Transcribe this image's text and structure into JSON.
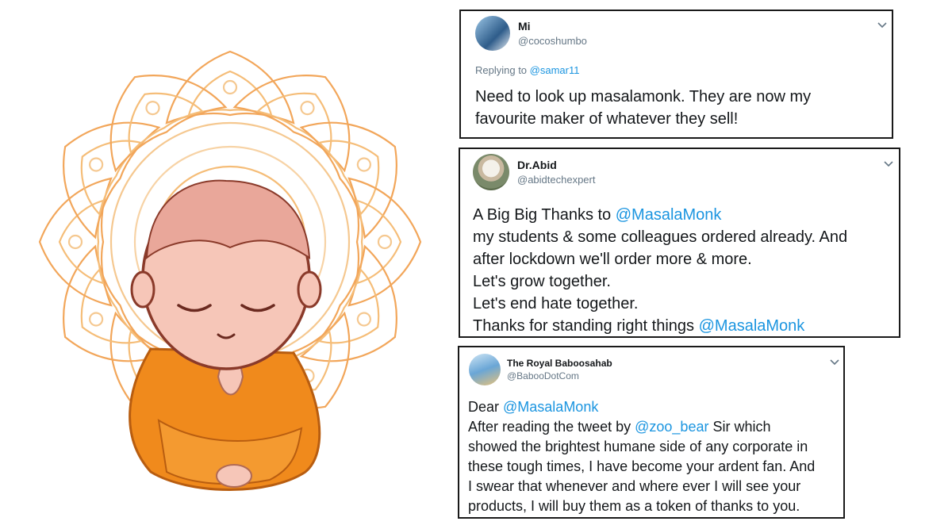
{
  "tweets": [
    {
      "name": "Mi",
      "handle": "@cocoshumbo",
      "reply_prefix": "Replying to",
      "reply_to": "@samar11",
      "lines": [
        "Need to look up masalamonk. They are now my",
        "favourite maker of whatever they sell!"
      ]
    },
    {
      "name": "Dr.Abid",
      "handle": "@abidtechexpert",
      "line1_text": "A Big Big Thanks to ",
      "line1_mention": "@MasalaMonk",
      "lines": [
        "my students & some colleagues ordered already. And",
        "after lockdown we'll order more & more.",
        "Let's grow together.",
        "Let's end hate together."
      ],
      "last_text": "Thanks for standing right things ",
      "last_mention": "@MasalaMonk"
    },
    {
      "name": "The Royal Baboosahab",
      "handle": "@BabooDotCom",
      "greeting": "Dear ",
      "greeting_mention": "@MasalaMonk",
      "line2_text": "After reading the tweet by ",
      "line2_mention": "@zoo_bear",
      "line2_rest": " Sir which",
      "lines": [
        "showed the brightest humane side of any corporate in",
        "these tough times, I have become your ardent fan. And",
        "I swear that whenever and where ever I will see your",
        "products, I will buy them as a token of thanks to you."
      ]
    }
  ],
  "colors": {
    "mention": "#1b95e0",
    "handle": "#657786",
    "mandala": "#f2a65a",
    "robe": "#f08a1c",
    "skin": "#f6c6b8"
  },
  "icons": [
    "monk-illustration",
    "mandala-ornament",
    "chevron-down-icon"
  ]
}
